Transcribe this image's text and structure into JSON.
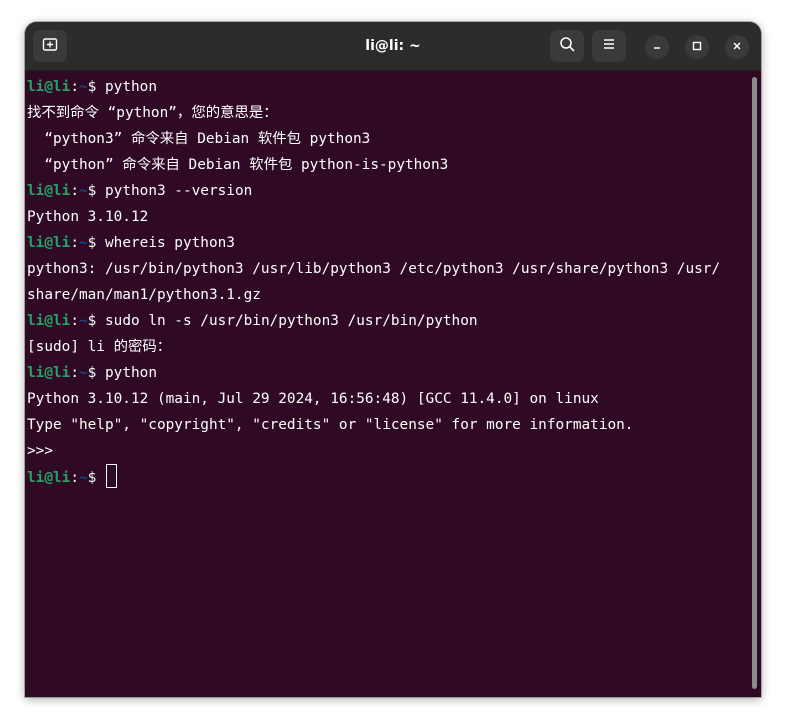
{
  "window": {
    "title": "li@li: ~"
  },
  "titlebar": {
    "new_tab_icon": "new-tab-icon",
    "search_icon": "search-icon",
    "menu_icon": "hamburger-menu-icon",
    "minimize_icon": "minimize-icon",
    "maximize_icon": "maximize-icon",
    "close_icon": "close-icon"
  },
  "colors": {
    "terminal_bg": "#300a24",
    "prompt_user": "#26a269",
    "prompt_path": "#12488b",
    "titlebar_bg": "#2c2c2c"
  },
  "prompt": {
    "user": "li@li",
    "sep": ":",
    "path": "~",
    "symbol": "$ "
  },
  "terminal": {
    "lines": [
      {
        "type": "prompt",
        "cmd": "python"
      },
      {
        "type": "output",
        "text": "找不到命令 “python”，您的意思是："
      },
      {
        "type": "output",
        "text": "  “python3” 命令来自 Debian 软件包 python3"
      },
      {
        "type": "output",
        "text": "  “python” 命令来自 Debian 软件包 python-is-python3"
      },
      {
        "type": "prompt",
        "cmd": "python3 --version"
      },
      {
        "type": "output",
        "text": "Python 3.10.12"
      },
      {
        "type": "prompt",
        "cmd": "whereis python3"
      },
      {
        "type": "output",
        "text": "python3: /usr/bin/python3 /usr/lib/python3 /etc/python3 /usr/share/python3 /usr/"
      },
      {
        "type": "output",
        "text": "share/man/man1/python3.1.gz"
      },
      {
        "type": "prompt",
        "cmd": "sudo ln -s /usr/bin/python3 /usr/bin/python"
      },
      {
        "type": "output",
        "text": "[sudo] li 的密码："
      },
      {
        "type": "prompt",
        "cmd": "python"
      },
      {
        "type": "output",
        "text": "Python 3.10.12 (main, Jul 29 2024, 16:56:48) [GCC 11.4.0] on linux"
      },
      {
        "type": "output",
        "text": "Type \"help\", \"copyright\", \"credits\" or \"license\" for more information."
      },
      {
        "type": "output",
        "text": ">>> "
      },
      {
        "type": "prompt",
        "cmd": "",
        "cursor": true
      }
    ]
  }
}
